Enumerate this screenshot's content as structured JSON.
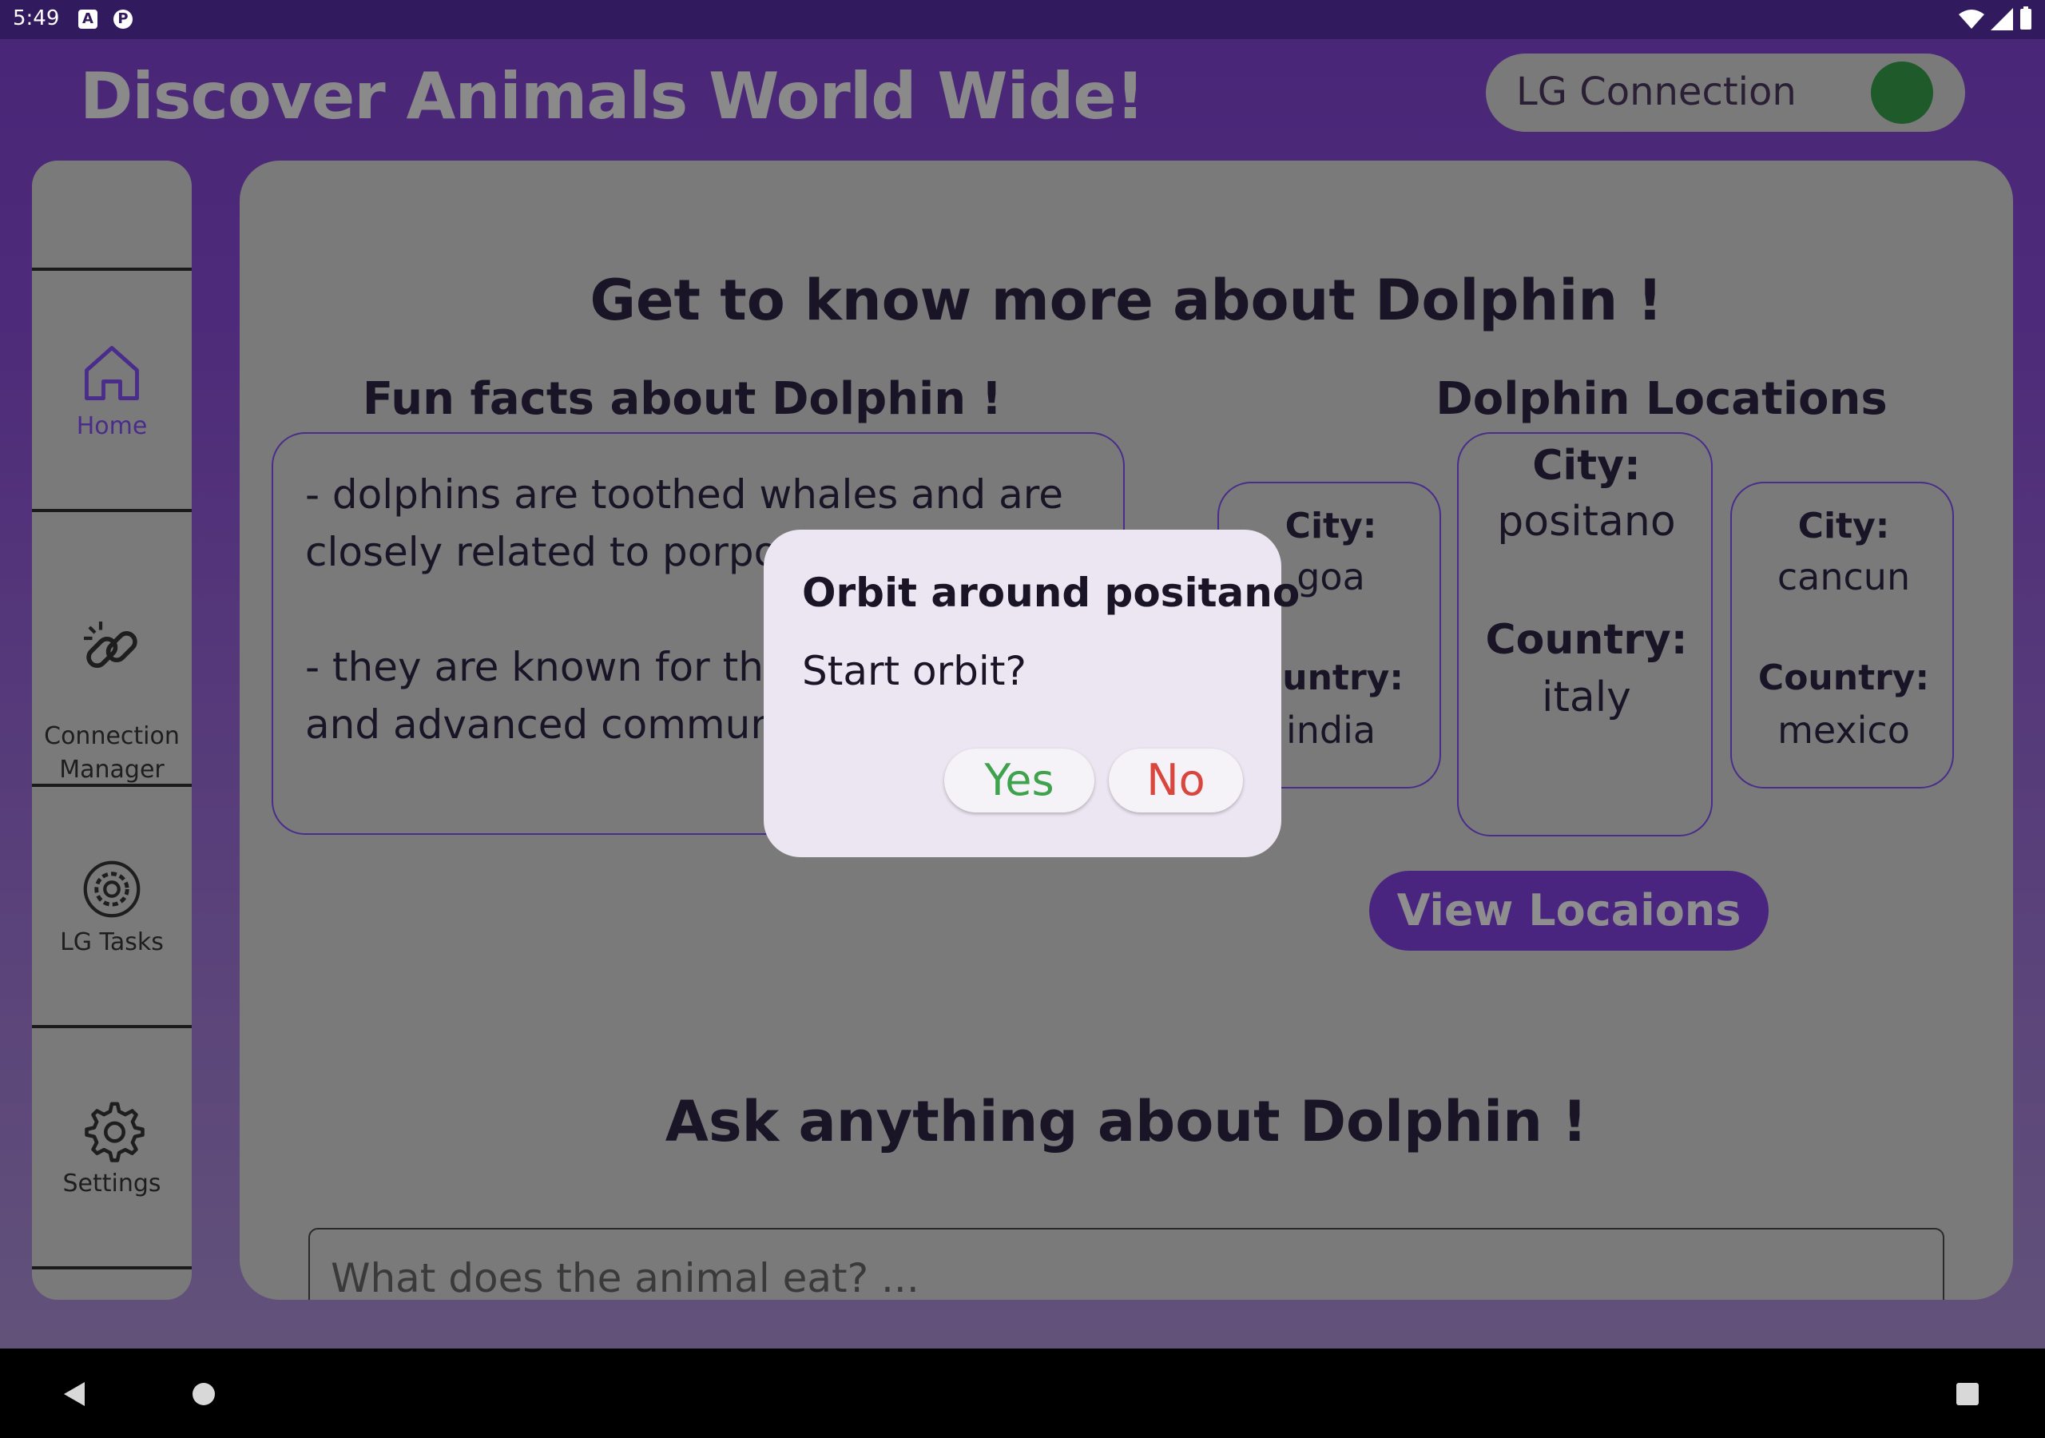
{
  "status_bar": {
    "time": "5:49",
    "icon_a": "A",
    "icon_b": "P"
  },
  "app": {
    "title": "Discover Animals World Wide!",
    "lg_connection": {
      "label": "LG Connection",
      "connected": true
    }
  },
  "sidebar": {
    "items": [
      {
        "label": "Home",
        "icon": "home-icon",
        "active": true
      },
      {
        "label": "Connection\nManager",
        "icon": "link-icon"
      },
      {
        "label": "LG Tasks",
        "icon": "gear-refresh-icon"
      },
      {
        "label": "Settings",
        "icon": "gear-icon"
      }
    ]
  },
  "main": {
    "heading": "Get to know more about Dolphin !",
    "facts_heading": "Fun facts about Dolphin !",
    "facts_text": "- dolphins are toothed whales and are closely related to porpoises\n\n- they are known for their intelligence and advanced communication",
    "locations_heading": "Dolphin Locations",
    "city_label": "City:",
    "country_label": "Country:",
    "country_label_clipped": "ountry:",
    "locations": [
      {
        "city": "goa",
        "country": "india"
      },
      {
        "city": "positano",
        "country": "italy"
      },
      {
        "city": "cancun",
        "country": "mexico"
      }
    ],
    "view_button": "View Locaions",
    "ask_heading": "Ask anything about Dolphin !",
    "ask_placeholder": "What does the animal eat? ..."
  },
  "dialog": {
    "title": "Orbit around positano",
    "message": "Start orbit?",
    "yes": "Yes",
    "no": "No"
  },
  "colors": {
    "yes": "#3fa34d",
    "no": "#d9463e",
    "accent": "#4a2580",
    "connected_dot": "#1e5a2a"
  }
}
